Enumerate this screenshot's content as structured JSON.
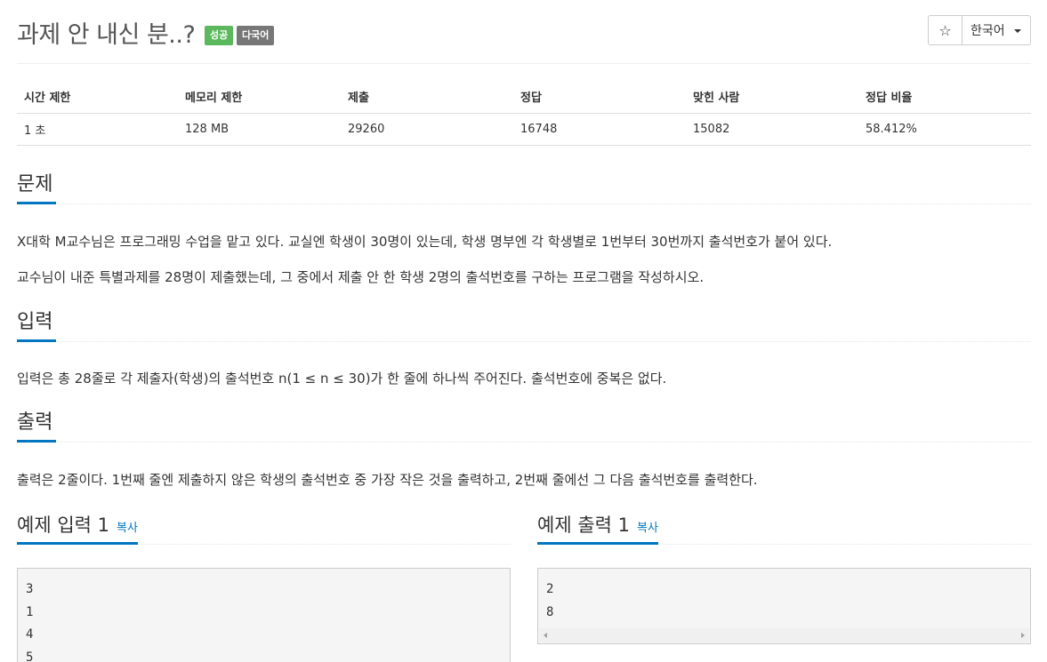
{
  "header": {
    "title": "과제 안 내신 분..?",
    "badge_status": "성공",
    "badge_lang": "다국어",
    "star_icon": "☆",
    "language": "한국어"
  },
  "info_table": {
    "headers": [
      "시간 제한",
      "메모리 제한",
      "제출",
      "정답",
      "맞힌 사람",
      "정답 비율"
    ],
    "values": [
      "1 초",
      "128 MB",
      "29260",
      "16748",
      "15082",
      "58.412%"
    ]
  },
  "problem": {
    "heading": "문제",
    "paragraphs": [
      "X대학 M교수님은 프로그래밍 수업을 맡고 있다. 교실엔 학생이 30명이 있는데, 학생 명부엔 각 학생별로 1번부터 30번까지 출석번호가 붙어 있다.",
      "교수님이 내준 특별과제를 28명이 제출했는데, 그 중에서 제출 안 한 학생 2명의 출석번호를 구하는 프로그램을 작성하시오."
    ]
  },
  "input": {
    "heading": "입력",
    "text": "입력은 총 28줄로 각 제출자(학생)의 출석번호 n(1 ≤ n ≤ 30)가 한 줄에 하나씩 주어진다. 출석번호에 중복은 없다."
  },
  "output": {
    "heading": "출력",
    "text": "출력은 2줄이다. 1번째 줄엔 제출하지 않은 학생의 출석번호 중 가장 작은 것을 출력하고, 2번째 줄에선 그 다음 출석번호를 출력한다."
  },
  "sample_input": {
    "heading": "예제 입력 1",
    "copy_label": "복사",
    "lines": [
      "3",
      "1",
      "4",
      "5"
    ]
  },
  "sample_output": {
    "heading": "예제 출력 1",
    "copy_label": "복사",
    "lines": [
      "2",
      "8"
    ]
  },
  "colors": {
    "accent": "#0076c0",
    "success_badge": "#5cb85c",
    "lang_badge": "#777777"
  }
}
